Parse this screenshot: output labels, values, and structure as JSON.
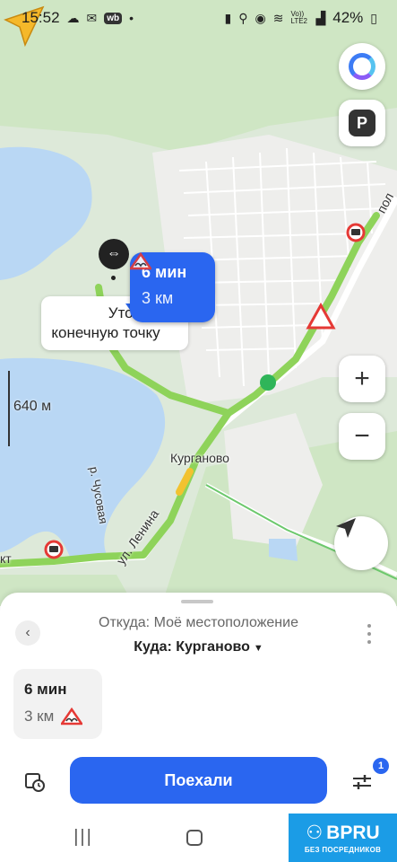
{
  "status_bar": {
    "time": "15:52",
    "battery": "42%",
    "network_label": "Vo)) LTE2",
    "icons": [
      "weather-icon",
      "mail-icon",
      "wb-app-icon",
      "dot-icon",
      "battery-saver-icon",
      "location-icon",
      "hotspot-icon",
      "wifi-icon",
      "signal-icon",
      "battery-icon"
    ],
    "wb_badge": "wb"
  },
  "map": {
    "scale_label": "640 м",
    "route_bubble": {
      "time": "6 мин",
      "distance": "3 км"
    },
    "hint_card": {
      "line1": "Уточни",
      "line2": "конечную точку"
    },
    "labels": {
      "town": "Курганово",
      "road_top_right": "пол",
      "road_lenina": "ул. Ленина",
      "river": "р. Чусовая",
      "road_left": "кт"
    },
    "colors": {
      "water": "#b9d7f4",
      "forest": "#cfe6c4",
      "route": "#8ed35a",
      "road": "#ffffff",
      "accent": "#2a66f0"
    },
    "buttons": {
      "alice": "alice-icon",
      "parking": "P",
      "zoom_in": "+",
      "zoom_out": "−",
      "locate": "navigation-arrow-icon"
    }
  },
  "sheet": {
    "from_label": "Откуда: Моё местоположение",
    "to_label": "Куда: Курганово",
    "option": {
      "time": "6 мин",
      "distance": "3 км"
    },
    "go_button": "Поехали",
    "settings_badge": "1"
  },
  "watermark": {
    "title": "BPRU",
    "subtitle": "БЕЗ ПОСРЕДНИКОВ"
  }
}
